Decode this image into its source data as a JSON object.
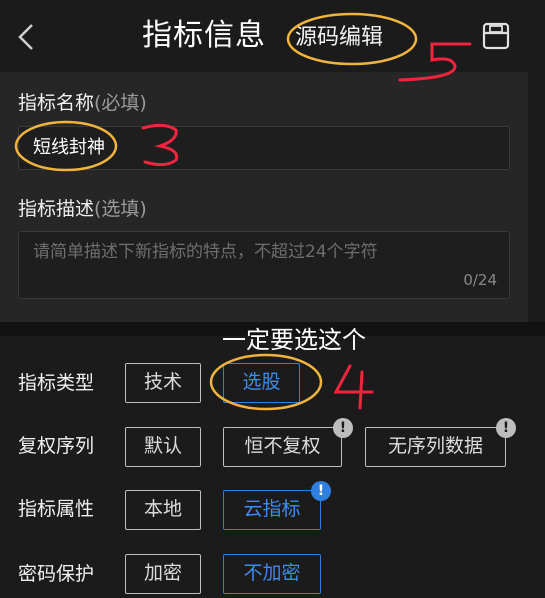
{
  "header": {
    "title": "指标信息",
    "source_edit_label": "源码编辑",
    "back_icon": "chevron-left-icon",
    "save_icon": "save-icon"
  },
  "form": {
    "name_label": "指标名称",
    "name_hint": "(必填)",
    "name_value": "短线封神",
    "desc_label": "指标描述",
    "desc_hint": "(选填)",
    "desc_placeholder": "请简单描述下新指标的特点，不超过24个字符",
    "desc_count": "0/24"
  },
  "options": {
    "type": {
      "label": "指标类型",
      "choices": [
        "技术",
        "选股"
      ],
      "selected": "选股"
    },
    "rights": {
      "label": "复权序列",
      "choices": [
        "默认",
        "恒不复权",
        "无序列数据"
      ],
      "selected": ""
    },
    "attr": {
      "label": "指标属性",
      "choices": [
        "本地",
        "云指标"
      ],
      "selected": "云指标"
    },
    "pwd": {
      "label": "密码保护",
      "choices": [
        "加密",
        "不加密"
      ],
      "selected": "不加密"
    },
    "badge_text": "!"
  },
  "annotations": {
    "note": "一定要选这个",
    "num3": "3",
    "num4": "4",
    "num5": "5"
  },
  "colors": {
    "background": "#1b1b1c",
    "card": "#262627",
    "accent_blue": "#2f7fe0",
    "annotation_orange": "#f0b43c",
    "annotation_red": "#f0243c"
  }
}
